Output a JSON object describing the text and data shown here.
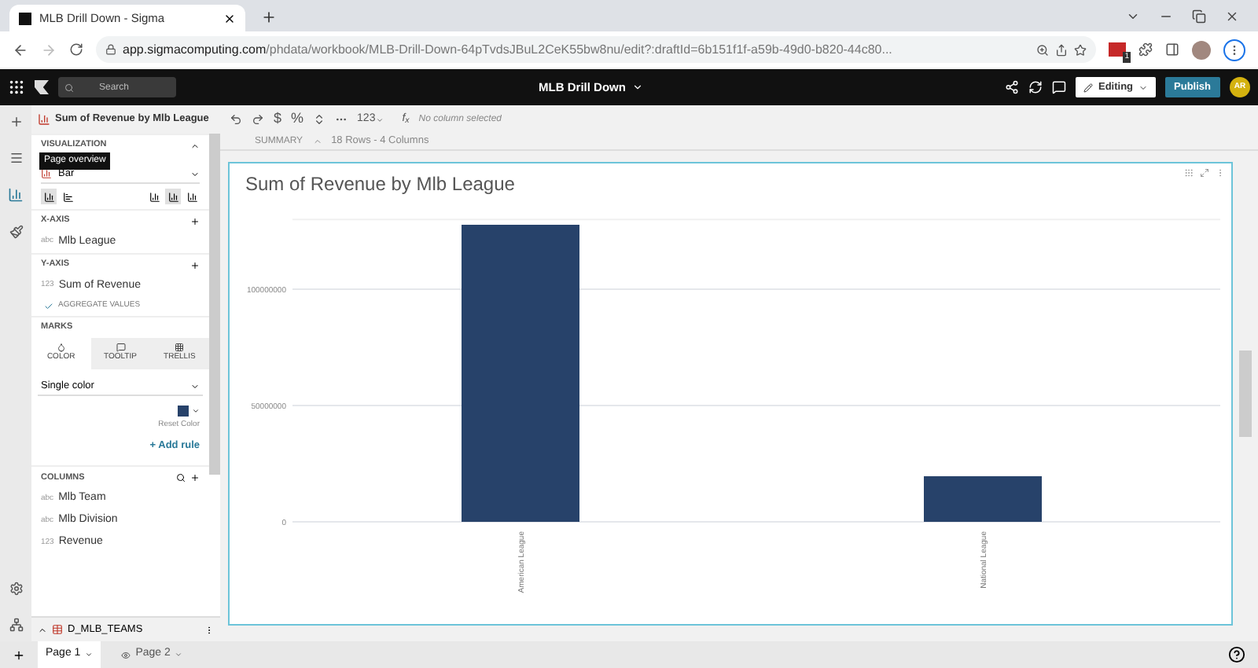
{
  "browser": {
    "tab_title": "MLB Drill Down - Sigma",
    "url_host": "app.sigmacomputing.com",
    "url_path": "/phdata/workbook/MLB-Drill-Down-64pTvdsJBuL2CeK55bw8nu/edit?:draftId=6b151f1f-a59b-49d0-b820-44c80...",
    "extension_badge": "1"
  },
  "app_bar": {
    "search_placeholder": "Search",
    "doc_title": "MLB Drill Down",
    "mode": "Editing",
    "publish": "Publish",
    "avatar": "AR"
  },
  "element_title": "Sum of Revenue by Mlb League",
  "toolbar": {
    "currency": "$",
    "percent": "%",
    "number_format": "123",
    "function_label": "f$_{x}$",
    "formula_placeholder": "No column selected"
  },
  "summary": {
    "label": "SUMMARY",
    "info": "18 Rows - 4 Columns"
  },
  "tooltip": "Page overview",
  "panel": {
    "visualization": {
      "label": "VISUALIZATION",
      "chart_type": "Bar",
      "orientation_options": [
        {
          "selected": true
        },
        {
          "selected": false
        }
      ],
      "layout_options": [
        {
          "selected": false
        },
        {
          "selected": true
        },
        {
          "selected": false
        }
      ]
    },
    "x_axis": {
      "label": "X-AXIS",
      "fields": [
        {
          "type": "abc",
          "name": "Mlb League"
        }
      ]
    },
    "y_axis": {
      "label": "Y-AXIS",
      "fields": [
        {
          "type": "123",
          "name": "Sum of Revenue"
        }
      ],
      "aggregate": {
        "label": "AGGREGATE VALUES",
        "checked": true
      }
    },
    "marks": {
      "label": "MARKS",
      "tabs": [
        {
          "label": "COLOR",
          "selected": true
        },
        {
          "label": "TOOLTIP",
          "selected": false
        },
        {
          "label": "TRELLIS",
          "selected": false
        }
      ],
      "color_mode": "Single color",
      "swatch": {
        "color": "#27426a"
      },
      "reset": "Reset Color",
      "add_rule": "+ Add rule"
    },
    "columns": {
      "label": "COLUMNS",
      "items": [
        {
          "type": "abc",
          "name": "Mlb Team"
        },
        {
          "type": "abc",
          "name": "Mlb Division"
        },
        {
          "type": "123",
          "name": "Revenue"
        }
      ]
    },
    "source": "D_MLB_TEAMS"
  },
  "chart": {
    "chart_data": {
      "type": "bar",
      "title": "Sum of Revenue by Mlb League",
      "categories": [
        "American League",
        "National League"
      ],
      "series": [
        {
          "color": "#27426a",
          "values": [
            127700000,
            19600000
          ]
        }
      ],
      "ylim": [
        0,
        130000000
      ],
      "yticks": [
        {
          "value": 0,
          "label": "0"
        },
        {
          "value": 50000000,
          "label": "50000000"
        },
        {
          "value": 100000000,
          "label": "100000000"
        }
      ]
    }
  },
  "pages": [
    {
      "label": "Page 1",
      "selected": true,
      "hidden": false
    },
    {
      "label": "Page 2",
      "selected": false,
      "hidden": true
    }
  ]
}
